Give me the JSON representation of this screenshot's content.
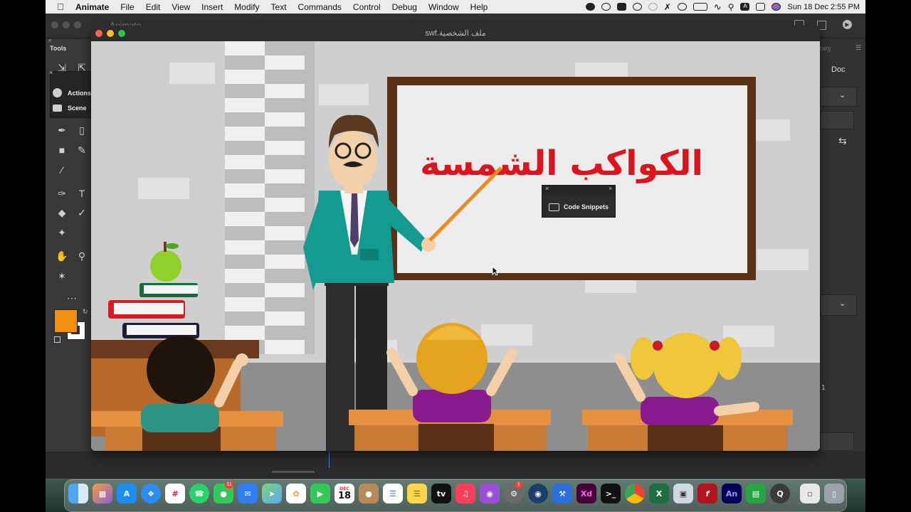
{
  "menubar": {
    "app_name": "Animate",
    "items": [
      "File",
      "Edit",
      "View",
      "Insert",
      "Modify",
      "Text",
      "Commands",
      "Control",
      "Debug",
      "Window",
      "Help"
    ],
    "clock": "Sun 18 Dec  2:55 PM",
    "status_icons": [
      "record-icon",
      "creative-cloud-icon",
      "bi-icon",
      "headset-icon",
      "spinner-icon",
      "bluetooth-icon",
      "time-machine-icon",
      "battery-icon",
      "wifi-icon",
      "search-icon",
      "input-a-icon",
      "control-center-icon",
      "siri-icon"
    ]
  },
  "animate_window": {
    "title": "Animate"
  },
  "tools_panel": {
    "title": "Tools",
    "fill_color": "#f0900e",
    "stroke_color": "#ffffff"
  },
  "actions_popup": {
    "items": [
      {
        "label": "Actions",
        "icon": "actions-icon"
      },
      {
        "label": "Scene",
        "icon": "scene-icon"
      }
    ]
  },
  "properties_panel": {
    "library_tab": "rary",
    "doc_tab": "Doc",
    "frame_value": "1"
  },
  "swf_window": {
    "title": "swf.ملف الشخصية"
  },
  "stage": {
    "board_text": "الكواكب الشمسة",
    "board_text_color": "#d9161f",
    "teacher_jacket_color": "#139b91",
    "pointer_color": "#f08a1c"
  },
  "code_snippets_panel": {
    "label": "Code Snippets",
    "close": "×",
    "collapse": "»"
  },
  "dock": {
    "calendar_month": "DEC",
    "calendar_day": "18",
    "messages_badge": "11",
    "settings_badge": "1",
    "apps": [
      "finder",
      "launchpad",
      "app-store",
      "safari",
      "slack",
      "whatsapp",
      "messages",
      "mail",
      "maps",
      "photos",
      "facetime",
      "calendar",
      "contacts",
      "reminders",
      "notes",
      "tv",
      "music",
      "podcasts",
      "system-settings",
      "screen-sharing",
      "xcode",
      "adobe-xd",
      "terminal",
      "chrome",
      "excel",
      "preview",
      "flash",
      "animate",
      "numbers",
      "quicktime",
      "trash"
    ]
  }
}
